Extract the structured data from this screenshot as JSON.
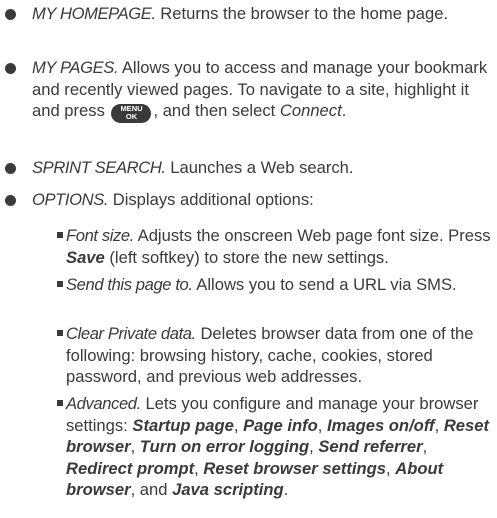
{
  "items": [
    {
      "term": "MY HOMEPAGE.",
      "description": " Returns the browser to the home page."
    },
    {
      "term": "MY PAGES.",
      "description_part1": " Allows you to access and manage your bookmark and recently viewed pages. To navigate to a site, highlight it and press ",
      "key_label_top": "MENU",
      "key_label_bottom": "OK",
      "description_part2": ", and then select ",
      "connect": "Connect",
      "period": "."
    },
    {
      "term": "SPRINT SEARCH.",
      "description": " Launches a Web search."
    },
    {
      "term": "OPTIONS.",
      "description": " Displays additional options:"
    }
  ],
  "sub_items": [
    {
      "term": "Font size.",
      "description_part1": " Adjusts the onscreen Web page font size. Press ",
      "save": "Save",
      "description_part2": " (left softkey) to store the new settings."
    },
    {
      "term": "Send this page to.",
      "description": " Allows you to send a URL via SMS."
    },
    {
      "term": "Clear Private data.",
      "description": " Deletes browser data from one of the following: browsing history, cache, cookies, stored password, and previous web addresses."
    },
    {
      "term": "Advanced.",
      "description_part1": " Lets you configure and manage your browser settings: ",
      "settings": [
        "Startup page",
        "Page info",
        "Images on/off",
        "Reset browser",
        "Turn on error logging",
        "Send referrer",
        "Redirect prompt",
        "Reset browser settings",
        "About browser",
        "Java scripting"
      ],
      "sep": ", ",
      "and_text": ", and ",
      "period": "."
    }
  ]
}
